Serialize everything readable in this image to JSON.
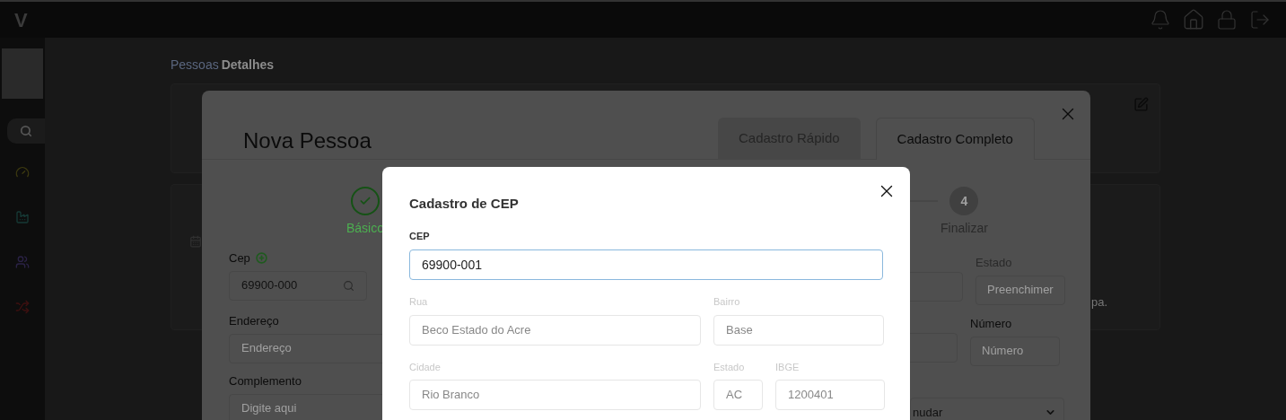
{
  "app": {
    "logo": "V"
  },
  "breadcrumb": {
    "parent": "Pessoas",
    "current": "Detalhes"
  },
  "background_text": "pa.",
  "person_modal": {
    "title": "Nova Pessoa",
    "tabs": [
      {
        "label": "Cadastro Rápido",
        "selected": false
      },
      {
        "label": "Cadastro Completo",
        "selected": true
      }
    ],
    "steps": [
      {
        "kind": "done",
        "label": "Básico"
      },
      {
        "kind": "pending",
        "number": "4",
        "label": "Finalizar"
      }
    ],
    "left_fields": [
      {
        "kind": "search",
        "label": "Cep",
        "value": "69900-000",
        "add": true
      },
      {
        "kind": "text",
        "label": "Endereço",
        "placeholder": "Endereço"
      },
      {
        "kind": "text",
        "label": "Complemento",
        "placeholder": "Digite aqui"
      }
    ],
    "right_fields": [
      {
        "kind": "text",
        "label": "Estado",
        "placeholder": "Preenchimer"
      },
      {
        "kind": "text",
        "label": "Número",
        "placeholder": "Número"
      },
      {
        "kind": "select",
        "value": "nudar"
      }
    ]
  },
  "cep_dialog": {
    "title": "Cadastro de CEP",
    "cep": {
      "label": "CEP",
      "value": "69900-001"
    },
    "rows": [
      [
        {
          "label": "Rua",
          "value": "Beco Estado do Acre",
          "disabled": true
        },
        {
          "label": "Bairro",
          "value": "Base",
          "disabled": true
        }
      ],
      [
        {
          "label": "Cidade",
          "value": "Rio Branco",
          "disabled": true
        },
        {
          "label": "Estado",
          "value": "AC",
          "disabled": true
        },
        {
          "label": "IBGE",
          "value": "1200401",
          "disabled": true
        }
      ]
    ]
  }
}
